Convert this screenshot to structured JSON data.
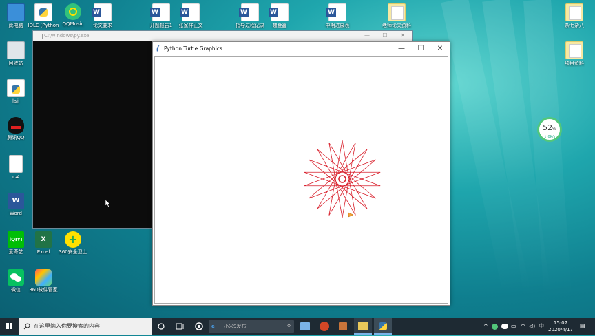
{
  "desktop_icons_left": [
    {
      "label": "此电脑",
      "icon": "computer-icon"
    },
    {
      "label": "回收站",
      "icon": "recycle-bin-icon"
    },
    {
      "label": "laji",
      "icon": "python-file-icon"
    },
    {
      "label": "腾讯QQ",
      "icon": "qq-icon"
    },
    {
      "label": "c#",
      "icon": "blank-file-icon"
    },
    {
      "label": "Word",
      "icon": "word-app-icon"
    },
    {
      "label": "爱奇艺",
      "icon": "iqiyi-icon"
    },
    {
      "label": "微信",
      "icon": "wechat-icon"
    }
  ],
  "desktop_icons_top": [
    {
      "label": "IDLE (Python",
      "icon": "idle-icon"
    },
    {
      "label": "QQMusic",
      "icon": "qqmusic-icon"
    },
    {
      "label": "论文要求",
      "icon": "word-doc-icon"
    },
    {
      "label": "开题报告1",
      "icon": "word-doc-icon"
    },
    {
      "label": "张家祥正文",
      "icon": "word-doc-icon"
    },
    {
      "label": "指导过程记录",
      "icon": "word-doc-icon"
    },
    {
      "label": "魏金鑫",
      "icon": "word-doc-icon"
    },
    {
      "label": "中期进展表",
      "icon": "word-doc-icon"
    },
    {
      "label": "老师论文资料",
      "icon": "folder-doc-icon"
    }
  ],
  "desktop_icons_right": [
    {
      "label": "杂七杂八",
      "icon": "folder-doc-icon"
    },
    {
      "label": "项目资料",
      "icon": "folder-doc-icon"
    }
  ],
  "desktop_icons_extra": [
    {
      "label": "Excel",
      "icon": "excel-icon"
    },
    {
      "label": "360安全卫士",
      "icon": "360-safe-icon"
    },
    {
      "label": "360软件管家",
      "icon": "360-software-icon"
    }
  ],
  "console_window": {
    "title": "C:\\Windows\\py.exe"
  },
  "turtle_window": {
    "title": "Python Turtle Graphics"
  },
  "net_widget": {
    "percent": "52",
    "unit": "%",
    "speed": "↓ 0K/s"
  },
  "taskbar": {
    "search_placeholder": "在这里输入你要搜索的内容",
    "browser_search_placeholder": "小米9发布",
    "ime": "中",
    "time": "15:07",
    "date": "2020/4/17"
  },
  "colors": {
    "turtle_line": "#d81e2a",
    "taskbar": "#1e2a33",
    "net_ring": "#52c77a"
  }
}
